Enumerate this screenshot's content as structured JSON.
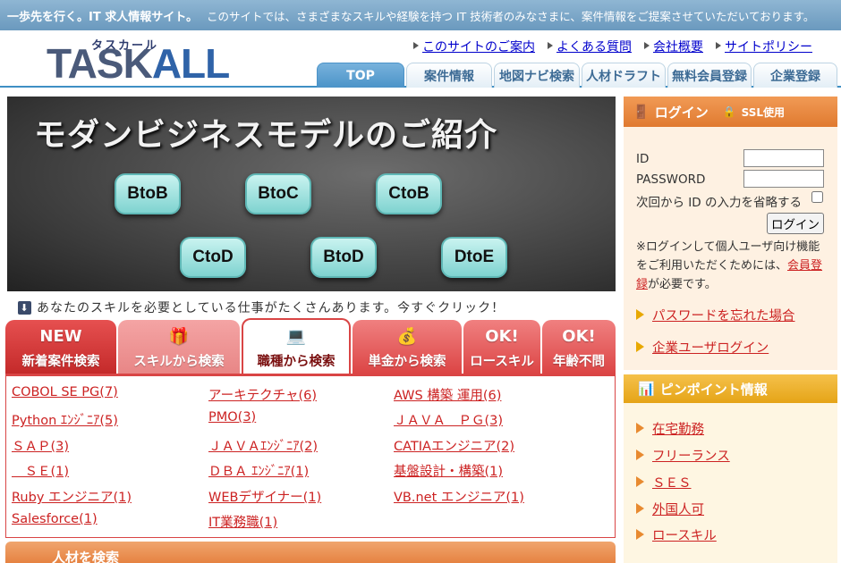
{
  "topbar": {
    "slogan": "一歩先を行く。IT 求人情報サイト。",
    "description": "このサイトでは、さまざまなスキルや経験を持つ IT 技術者のみなさまに、案件情報をご提案させていただいております。"
  },
  "logo": {
    "ruby": "タスカール",
    "main_a": "TASK",
    "main_b": "ALL"
  },
  "toplinks": [
    "このサイトのご案内",
    "よくある質問",
    "会社概要",
    "サイトポリシー"
  ],
  "navtabs": [
    "TOP",
    "案件情報",
    "地図ナビ検索",
    "人材ドラフト",
    "無料会員登録",
    "企業登録"
  ],
  "hero": {
    "title": "モダンビジネスモデルのご紹介",
    "models": [
      "BtoB",
      "BtoC",
      "CtoB",
      "CtoD",
      "BtoD",
      "DtoE"
    ]
  },
  "notice": "あなたのスキルを必要としている仕事がたくさんあります。今すぐクリック！",
  "category_tabs": [
    {
      "glyph": "NEW",
      "label": "新着案件検索"
    },
    {
      "glyph": "🎁",
      "label": "スキルから検索"
    },
    {
      "glyph": "💻",
      "label": "職種から検索"
    },
    {
      "glyph": "💰",
      "label": "単金から検索"
    },
    {
      "glyph": "OK!",
      "label": "ロースキル"
    },
    {
      "glyph": "OK!",
      "label": "年齢不問"
    }
  ],
  "jobs": [
    "COBOL SE PG(7)",
    "アーキテクチャ(6)",
    "AWS 構築 運用(6)",
    "Python ｴﾝｼﾞﾆｱ(5)",
    "PMO(3)",
    "ＪＡＶＡ　ＰＧ(3)",
    "ＳＡＰ(3)",
    "ＪＡＶＡｴﾝｼﾞﾆｱ(2)",
    "CATIAエンジニア(2)",
    "　ＳＥ(1)",
    "ＤＢＡ ｴﾝｼﾞﾆｱ(1)",
    "基盤設計・構築(1)",
    "Ruby エンジニア(1)",
    "WEBデザイナー(1)",
    "VB.net エンジニア(1)",
    "Salesforce(1)",
    "IT業務職(1)"
  ],
  "bottombar": "人材を検索",
  "login": {
    "header": "ログイン",
    "ssl": "SSL使用",
    "id_label": "ID",
    "password_label": "PASSWORD",
    "remember_label": "次回から ID の入力を省略する",
    "button": "ログイン",
    "note_before": "※ログインして個人ユーザ向け機能をご利用いただくためには、",
    "note_link": "会員登録",
    "note_after": "が必要です。",
    "forgot": "パスワードを忘れた場合",
    "corp_login": "企業ユーザログイン"
  },
  "pinpoint": {
    "header": "ピンポイント情報",
    "items": [
      "在宅勤務",
      "フリーランス",
      "ＳＥＳ",
      "外国人可",
      "ロースキル"
    ]
  },
  "colors": {
    "accent_red": "#d94545",
    "nav_blue": "#4b93c8",
    "orange": "#e07a30",
    "gold": "#e5a417"
  }
}
